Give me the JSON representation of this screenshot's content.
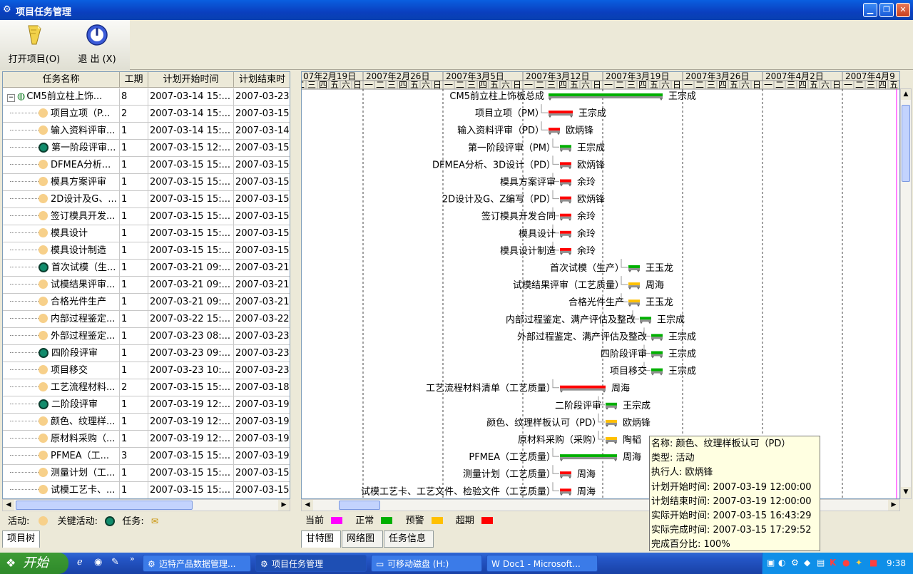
{
  "window": {
    "title": "项目任务管理",
    "app_icon": "gear-icon"
  },
  "toolbar": {
    "open_label": "打开项目(O)",
    "exit_label": "退 出 (X)"
  },
  "grid": {
    "columns": [
      "任务名称",
      "工期",
      "计划开始时间",
      "计划结束时"
    ],
    "rows": [
      {
        "name": "CM5前立柱上饰...",
        "dur": "8",
        "start": "2007-03-14 15:...",
        "end": "2007-03-23",
        "kind": "root"
      },
      {
        "name": "项目立项（P...",
        "dur": "2",
        "start": "2007-03-14 15:...",
        "end": "2007-03-15",
        "kind": "act"
      },
      {
        "name": "输入资料评审...",
        "dur": "1",
        "start": "2007-03-14 15:...",
        "end": "2007-03-14",
        "kind": "act"
      },
      {
        "name": "第一阶段评审...",
        "dur": "1",
        "start": "2007-03-15 12:...",
        "end": "2007-03-15",
        "kind": "key"
      },
      {
        "name": "DFMEA分析...",
        "dur": "1",
        "start": "2007-03-15 15:...",
        "end": "2007-03-15",
        "kind": "act"
      },
      {
        "name": "模具方案评审",
        "dur": "1",
        "start": "2007-03-15 15:...",
        "end": "2007-03-15",
        "kind": "act"
      },
      {
        "name": "2D设计及G、...",
        "dur": "1",
        "start": "2007-03-15 15:...",
        "end": "2007-03-15",
        "kind": "act"
      },
      {
        "name": "签订模具开发...",
        "dur": "1",
        "start": "2007-03-15 15:...",
        "end": "2007-03-15",
        "kind": "act"
      },
      {
        "name": "模具设计",
        "dur": "1",
        "start": "2007-03-15 15:...",
        "end": "2007-03-15",
        "kind": "act"
      },
      {
        "name": "模具设计制造",
        "dur": "1",
        "start": "2007-03-15 15:...",
        "end": "2007-03-15",
        "kind": "act"
      },
      {
        "name": "首次试模（生...",
        "dur": "1",
        "start": "2007-03-21 09:...",
        "end": "2007-03-21",
        "kind": "key"
      },
      {
        "name": "试模结果评审...",
        "dur": "1",
        "start": "2007-03-21 09:...",
        "end": "2007-03-21",
        "kind": "act"
      },
      {
        "name": "合格光件生产",
        "dur": "1",
        "start": "2007-03-21 09:...",
        "end": "2007-03-21",
        "kind": "act"
      },
      {
        "name": "内部过程鉴定...",
        "dur": "1",
        "start": "2007-03-22 15:...",
        "end": "2007-03-22",
        "kind": "act"
      },
      {
        "name": "外部过程鉴定...",
        "dur": "1",
        "start": "2007-03-23 08:...",
        "end": "2007-03-23",
        "kind": "act"
      },
      {
        "name": "四阶段评审",
        "dur": "1",
        "start": "2007-03-23 09:...",
        "end": "2007-03-23",
        "kind": "key"
      },
      {
        "name": "项目移交",
        "dur": "1",
        "start": "2007-03-23 10:...",
        "end": "2007-03-23",
        "kind": "act"
      },
      {
        "name": "工艺流程材料...",
        "dur": "2",
        "start": "2007-03-15 15:...",
        "end": "2007-03-18",
        "kind": "act"
      },
      {
        "name": "二阶段评审",
        "dur": "1",
        "start": "2007-03-19 12:...",
        "end": "2007-03-19",
        "kind": "key"
      },
      {
        "name": "颜色、纹理样...",
        "dur": "1",
        "start": "2007-03-19 12:...",
        "end": "2007-03-19",
        "kind": "act"
      },
      {
        "name": "原材料采购（...",
        "dur": "1",
        "start": "2007-03-19 12:...",
        "end": "2007-03-19",
        "kind": "act"
      },
      {
        "name": "PFMEA（工...",
        "dur": "3",
        "start": "2007-03-15 15:...",
        "end": "2007-03-19",
        "kind": "act"
      },
      {
        "name": "测量计划（工...",
        "dur": "1",
        "start": "2007-03-15 15:...",
        "end": "2007-03-15",
        "kind": "act"
      },
      {
        "name": "试模工艺卡、...",
        "dur": "1",
        "start": "2007-03-15 15:...",
        "end": "2007-03-15",
        "kind": "act"
      }
    ]
  },
  "legend_left": {
    "activity": "活动:",
    "key_activity": "关键活动:",
    "task": "任务:"
  },
  "left_tabs": [
    "项目树"
  ],
  "gantt": {
    "weeks": [
      "07年2月19日",
      "2007年2月26日",
      "2007年3月5日",
      "2007年3月12日",
      "2007年3月19日",
      "2007年3月26日",
      "2007年4月2日",
      "2007年4月9"
    ],
    "days": [
      "一",
      "二",
      "三",
      "四",
      "五",
      "六",
      "日"
    ],
    "tasks": [
      {
        "label": "CM5前立柱上饰板总成",
        "owner": "王宗成",
        "status": "normal",
        "bx": 768,
        "bw": 160
      },
      {
        "label": "项目立项（PM）",
        "owner": "王宗成",
        "status": "overdue",
        "bx": 768,
        "bw": 34
      },
      {
        "label": "输入资料评审（PD）",
        "owner": "欧炳锋",
        "status": "overdue",
        "bx": 768,
        "bw": 16
      },
      {
        "label": "第一阶段评审（PM）",
        "owner": "王宗成",
        "status": "normal",
        "bx": 784,
        "bw": 16
      },
      {
        "label": "DFMEA分析、3D设计（PD）",
        "owner": "欧炳锋",
        "status": "overdue",
        "bx": 784,
        "bw": 16
      },
      {
        "label": "模具方案评审",
        "owner": "余玲",
        "status": "overdue",
        "bx": 784,
        "bw": 16
      },
      {
        "label": "2D设计及G、Z编写（PD）",
        "owner": "欧炳锋",
        "status": "overdue",
        "bx": 784,
        "bw": 16
      },
      {
        "label": "签订模具开发合同",
        "owner": "余玲",
        "status": "overdue",
        "bx": 784,
        "bw": 16
      },
      {
        "label": "模具设计",
        "owner": "余玲",
        "status": "overdue",
        "bx": 784,
        "bw": 16
      },
      {
        "label": "模具设计制造",
        "owner": "余玲",
        "status": "overdue",
        "bx": 784,
        "bw": 16
      },
      {
        "label": "首次试模（生产）",
        "owner": "王玉龙",
        "status": "normal",
        "bx": 880,
        "bw": 16
      },
      {
        "label": "试模结果评审（工艺质量）",
        "owner": "周海",
        "status": "warning",
        "bx": 880,
        "bw": 16
      },
      {
        "label": "合格光件生产",
        "owner": "王玉龙",
        "status": "warning",
        "bx": 880,
        "bw": 16
      },
      {
        "label": "内部过程鉴定、满产评估及整改",
        "owner": "王宗成",
        "status": "normal",
        "bx": 896,
        "bw": 16
      },
      {
        "label": "外部过程鉴定、满产评估及整改",
        "owner": "王宗成",
        "status": "normal",
        "bx": 912,
        "bw": 16
      },
      {
        "label": "四阶段评审",
        "owner": "王宗成",
        "status": "normal",
        "bx": 912,
        "bw": 16
      },
      {
        "label": "项目移交",
        "owner": "王宗成",
        "status": "normal",
        "bx": 912,
        "bw": 16
      },
      {
        "label": "工艺流程材料清单（工艺质量）",
        "owner": "周海",
        "status": "overdue",
        "bx": 784,
        "bw": 64
      },
      {
        "label": "二阶段评审",
        "owner": "王宗成",
        "status": "normal",
        "bx": 848,
        "bw": 16
      },
      {
        "label": "颜色、纹理样板认可（PD）",
        "owner": "欧炳锋",
        "status": "warning",
        "bx": 848,
        "bw": 16
      },
      {
        "label": "原材料采购（采购）",
        "owner": "陶韬",
        "status": "warning",
        "bx": 848,
        "bw": 16
      },
      {
        "label": "PFMEA（工艺质量）",
        "owner": "周海",
        "status": "normal",
        "bx": 784,
        "bw": 80
      },
      {
        "label": "测量计划（工艺质量）",
        "owner": "周海",
        "status": "overdue",
        "bx": 784,
        "bw": 16
      },
      {
        "label": "试模工艺卡、工艺文件、检验文件（工艺质量）",
        "owner": "周海",
        "status": "overdue",
        "bx": 784,
        "bw": 16
      }
    ]
  },
  "legend_right": {
    "current": "当前",
    "normal": "正常",
    "warning": "预警",
    "overdue": "超期"
  },
  "colors": {
    "current": "#ff00ff",
    "normal": "#00b000",
    "warning": "#ffc000",
    "overdue": "#ff0000"
  },
  "right_tabs": [
    "甘特图",
    "网络图",
    "任务信息"
  ],
  "tooltip": [
    "名称: 颜色、纹理样板认可（PD）",
    "类型: 活动",
    "执行人: 欧炳锋",
    "计划开始时间: 2007-03-19 12:00:00",
    "计划结束时间: 2007-03-19 12:00:00",
    "实际开始时间: 2007-03-15 16:43:29",
    "实际完成时间: 2007-03-15 17:29:52",
    "完成百分比: 100%"
  ],
  "taskbar": {
    "start": "开始",
    "tasks": [
      "迈特产品数据管理...",
      "项目任务管理",
      "可移动磁盘 (H:)",
      "Doc1 - Microsoft..."
    ],
    "clock": "9:38"
  }
}
